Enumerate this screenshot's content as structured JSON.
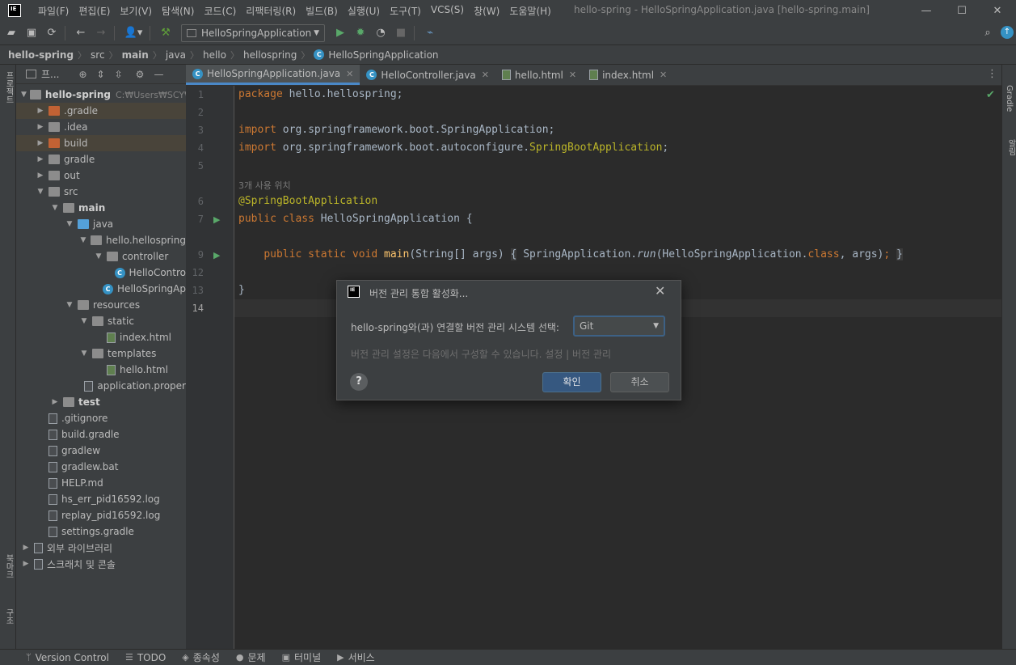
{
  "titlebar": {
    "menus": [
      "파일(F)",
      "편집(E)",
      "보기(V)",
      "탐색(N)",
      "코드(C)",
      "리팩터링(R)",
      "빌드(B)",
      "실행(U)",
      "도구(T)",
      "VCS(S)",
      "창(W)",
      "도움말(H)"
    ],
    "window_title": "hello-spring - HelloSpringApplication.java [hello-spring.main]",
    "app_logo": "IE"
  },
  "toolbar": {
    "run_config": "HelloSpringApplication"
  },
  "breadcrumb": [
    "hello-spring",
    "src",
    "main",
    "java",
    "hello",
    "hellospring",
    "HelloSpringApplication"
  ],
  "project": {
    "header_label": "프...",
    "root": "hello-spring",
    "root_path": "C:₩Users₩SCY₩D",
    "tree": [
      {
        "label": ".gradle",
        "depth": 1,
        "arrow": "▶",
        "icon": "folder orange",
        "hl": true
      },
      {
        "label": ".idea",
        "depth": 1,
        "arrow": "▶",
        "icon": "folder"
      },
      {
        "label": "build",
        "depth": 1,
        "arrow": "▶",
        "icon": "folder orange",
        "hl": true
      },
      {
        "label": "gradle",
        "depth": 1,
        "arrow": "▶",
        "icon": "folder"
      },
      {
        "label": "out",
        "depth": 1,
        "arrow": "▶",
        "icon": "folder"
      },
      {
        "label": "src",
        "depth": 1,
        "arrow": "▼",
        "icon": "folder"
      },
      {
        "label": "main",
        "depth": 2,
        "arrow": "▼",
        "icon": "folder",
        "bold": true
      },
      {
        "label": "java",
        "depth": 3,
        "arrow": "▼",
        "icon": "folder blue"
      },
      {
        "label": "hello.hellospring",
        "depth": 4,
        "arrow": "▼",
        "icon": "folder"
      },
      {
        "label": "controller",
        "depth": 5,
        "arrow": "▼",
        "icon": "folder"
      },
      {
        "label": "HelloContro",
        "depth": 6,
        "arrow": "",
        "icon": "class"
      },
      {
        "label": "HelloSpringAp",
        "depth": 5,
        "arrow": "",
        "icon": "class"
      },
      {
        "label": "resources",
        "depth": 3,
        "arrow": "▼",
        "icon": "folder"
      },
      {
        "label": "static",
        "depth": 4,
        "arrow": "▼",
        "icon": "folder"
      },
      {
        "label": "index.html",
        "depth": 5,
        "arrow": "",
        "icon": "html"
      },
      {
        "label": "templates",
        "depth": 4,
        "arrow": "▼",
        "icon": "folder"
      },
      {
        "label": "hello.html",
        "depth": 5,
        "arrow": "",
        "icon": "html"
      },
      {
        "label": "application.proper",
        "depth": 4,
        "arrow": "",
        "icon": "file"
      },
      {
        "label": "test",
        "depth": 2,
        "arrow": "▶",
        "icon": "folder",
        "bold": true
      },
      {
        "label": ".gitignore",
        "depth": 1,
        "arrow": "",
        "icon": "file"
      },
      {
        "label": "build.gradle",
        "depth": 1,
        "arrow": "",
        "icon": "file"
      },
      {
        "label": "gradlew",
        "depth": 1,
        "arrow": "",
        "icon": "file"
      },
      {
        "label": "gradlew.bat",
        "depth": 1,
        "arrow": "",
        "icon": "file"
      },
      {
        "label": "HELP.md",
        "depth": 1,
        "arrow": "",
        "icon": "file"
      },
      {
        "label": "hs_err_pid16592.log",
        "depth": 1,
        "arrow": "",
        "icon": "file"
      },
      {
        "label": "replay_pid16592.log",
        "depth": 1,
        "arrow": "",
        "icon": "file"
      },
      {
        "label": "settings.gradle",
        "depth": 1,
        "arrow": "",
        "icon": "file"
      },
      {
        "label": "외부 라이브러리",
        "depth": 0,
        "arrow": "▶",
        "icon": "file"
      },
      {
        "label": "스크래치 및 콘솔",
        "depth": 0,
        "arrow": "▶",
        "icon": "file"
      }
    ]
  },
  "tabs": [
    {
      "label": "HelloSpringApplication.java",
      "active": true
    },
    {
      "label": "HelloController.java",
      "active": false
    },
    {
      "label": "hello.html",
      "active": false
    },
    {
      "label": "index.html",
      "active": false
    }
  ],
  "editor": {
    "usage_hint": "3개 사용 위치",
    "line_numbers": [
      "1",
      "2",
      "3",
      "4",
      "5",
      "6",
      "7",
      "9",
      "12",
      "13",
      "14"
    ]
  },
  "left_strip": {
    "project": "프로젝트",
    "bookmarks": "북마크",
    "structure": "구조"
  },
  "right_strip": {
    "gradle": "Gradle",
    "notifications": "알림"
  },
  "statusbar": [
    "Version Control",
    "TODO",
    "종속성",
    "문제",
    "터미널",
    "서비스"
  ],
  "dialog": {
    "title": "버전 관리 통합 활성화...",
    "label": "hello-spring와(과) 연결할 버전 관리 시스템 선택:",
    "selected": "Git",
    "hint": "버전 관리 설정은 다음에서 구성할 수 있습니다. 설정 | 버전 관리",
    "ok": "확인",
    "cancel": "취소",
    "help": "?"
  }
}
